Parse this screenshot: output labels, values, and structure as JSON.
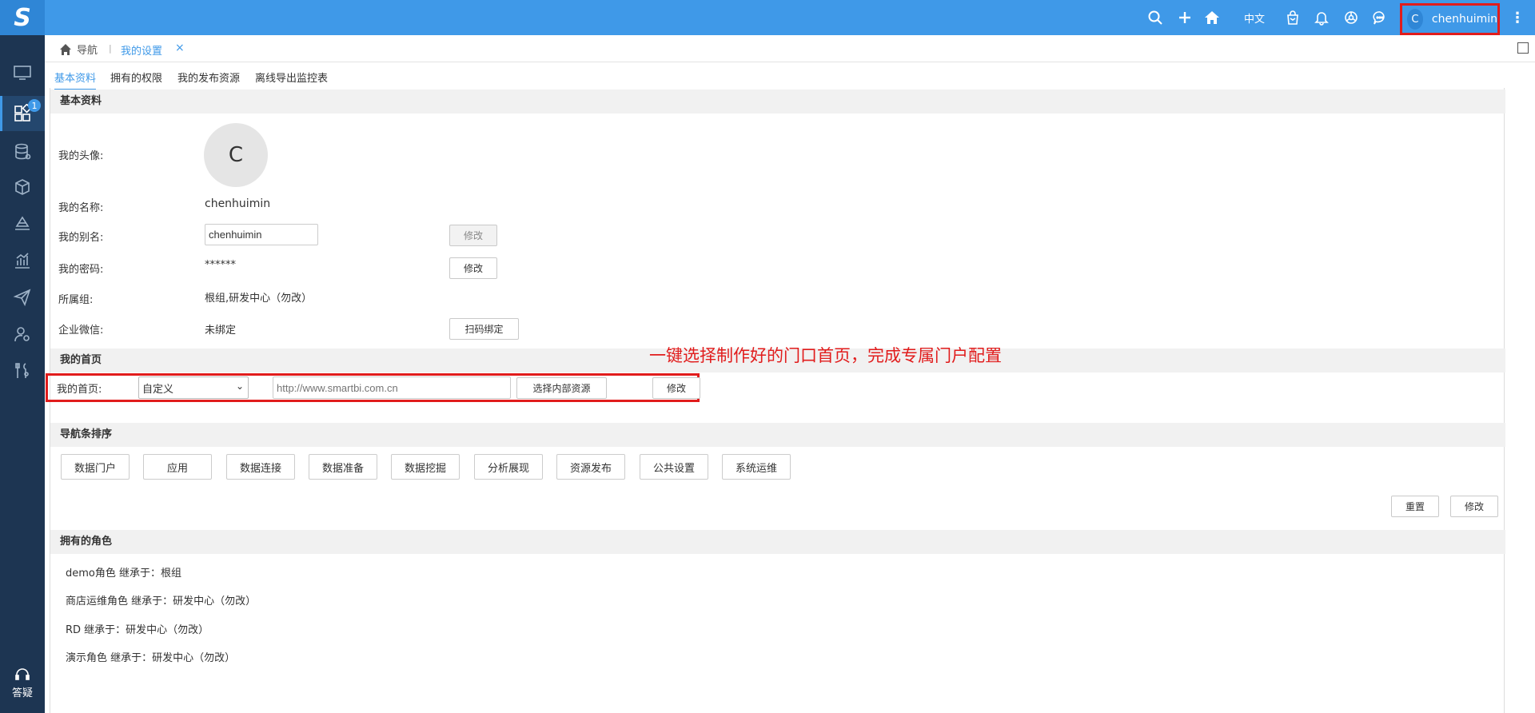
{
  "app": {
    "logo": "S",
    "language": "中文",
    "user": {
      "initial": "C",
      "name": "chenhuimin"
    },
    "top_icons": [
      "search-icon",
      "plus-icon",
      "home-icon",
      "bag-icon",
      "bell-icon",
      "hub-icon",
      "chat-icon",
      "more-vertical-icon"
    ],
    "accent": "#3f99e8",
    "sidebar_color": "#1d3552",
    "highlight_color": "#e11c1c"
  },
  "sidebar": {
    "badge": "1",
    "help_label": "答疑",
    "items": [
      "monitor-icon",
      "apps-icon",
      "database-icon",
      "cube-icon",
      "layers-icon",
      "chart-icon",
      "send-icon",
      "user-gear-icon",
      "tools-icon"
    ]
  },
  "tabs": {
    "home_label": "导航",
    "separator": "|",
    "active_label": "我的设置",
    "close": "×"
  },
  "subtabs": [
    "基本资料",
    "拥有的权限",
    "我的发布资源",
    "离线导出监控表"
  ],
  "basic": {
    "header": "基本资料",
    "avatar_label": "我的头像:",
    "avatar_initial": "C",
    "name_label": "我的名称:",
    "name_value": "chenhuimin",
    "alias_label": "我的别名:",
    "alias_value": "chenhuimin",
    "alias_button": "修改",
    "password_label": "我的密码:",
    "password_value": "******",
    "password_button": "修改",
    "group_label": "所属组:",
    "group_value": "根组,研发中心（勿改）",
    "wechat_label": "企业微信:",
    "wechat_value": "未绑定",
    "wechat_button": "扫码绑定"
  },
  "homepage": {
    "header": "我的首页",
    "label": "我的首页:",
    "select_value": "自定义",
    "url_placeholder": "http://www.smartbi.com.cn",
    "choose_button": "选择内部资源",
    "edit_button": "修改",
    "annotation": "一键选择制作好的门口首页，完成专属门户配置"
  },
  "nav_sort": {
    "header": "导航条排序",
    "items": [
      "数据门户",
      "应用",
      "数据连接",
      "数据准备",
      "数据挖掘",
      "分析展现",
      "资源发布",
      "公共设置",
      "系统运维"
    ],
    "reset_button": "重置",
    "edit_button": "修改"
  },
  "roles": {
    "header": "拥有的角色",
    "items": [
      "demo角色 继承于：根组",
      "商店运维角色 继承于：研发中心（勿改）",
      "RD 继承于：研发中心（勿改）",
      "演示角色 继承于：研发中心（勿改）"
    ]
  }
}
